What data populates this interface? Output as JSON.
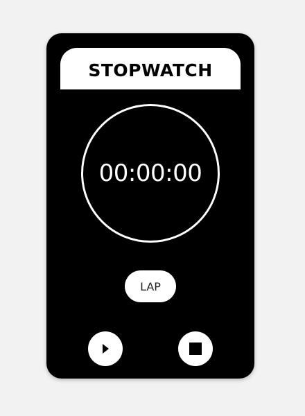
{
  "app": {
    "title": "STOPWATCH"
  },
  "display": {
    "time": "00:00:00"
  },
  "controls": {
    "lap_label": "LAP",
    "play_icon": "play-icon",
    "stop_icon": "stop-icon"
  },
  "colors": {
    "background": "#f2f2f2",
    "device": "#000000",
    "foreground": "#ffffff"
  }
}
